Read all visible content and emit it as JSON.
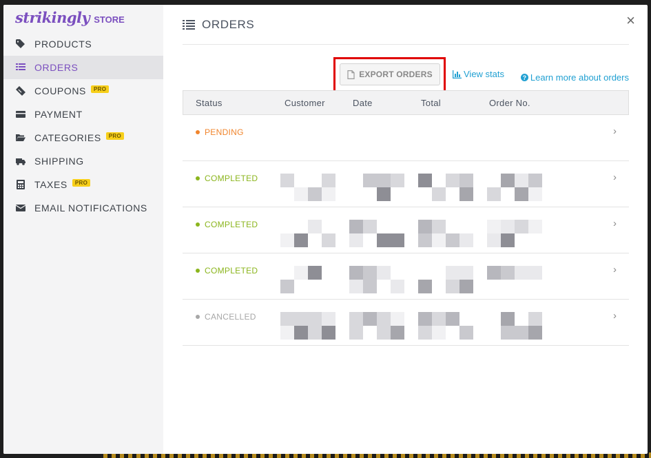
{
  "brand": {
    "logo": "strikingly",
    "suffix": "STORE"
  },
  "sidebar": {
    "items": [
      {
        "label": "PRODUCTS",
        "icon": "tag-icon",
        "active": false,
        "pro": ""
      },
      {
        "label": "ORDERS",
        "icon": "list-icon",
        "active": true,
        "pro": ""
      },
      {
        "label": "COUPONS",
        "icon": "ticket-icon",
        "active": false,
        "pro": "PRO"
      },
      {
        "label": "PAYMENT",
        "icon": "credit-card-icon",
        "active": false,
        "pro": ""
      },
      {
        "label": "CATEGORIES",
        "icon": "folder-icon",
        "active": false,
        "pro": "PRO"
      },
      {
        "label": "SHIPPING",
        "icon": "truck-icon",
        "active": false,
        "pro": ""
      },
      {
        "label": "TAXES",
        "icon": "calculator-icon",
        "active": false,
        "pro": "PRO"
      },
      {
        "label": "EMAIL NOTIFICATIONS",
        "icon": "envelope-icon",
        "active": false,
        "pro": ""
      }
    ]
  },
  "header": {
    "title": "ORDERS",
    "close": "×"
  },
  "toolbar": {
    "export_label": "EXPORT ORDERS",
    "stats_label": "View stats",
    "learn_label": "Learn more about orders",
    "learn_glyph": "?"
  },
  "table": {
    "columns": [
      "Status",
      "Customer",
      "Date",
      "Total",
      "Order No."
    ],
    "rows": [
      {
        "status": "PENDING",
        "color": "#f0852d"
      },
      {
        "status": "COMPLETED",
        "color": "#8bb51d"
      },
      {
        "status": "COMPLETED",
        "color": "#8bb51d"
      },
      {
        "status": "COMPLETED",
        "color": "#8bb51d"
      },
      {
        "status": "CANCELLED",
        "color": "#a7a7a7"
      }
    ],
    "chevron": "›"
  },
  "colors": {
    "accent": "#7b4fbf",
    "link": "#21a0d2",
    "highlight": "#e00000"
  }
}
